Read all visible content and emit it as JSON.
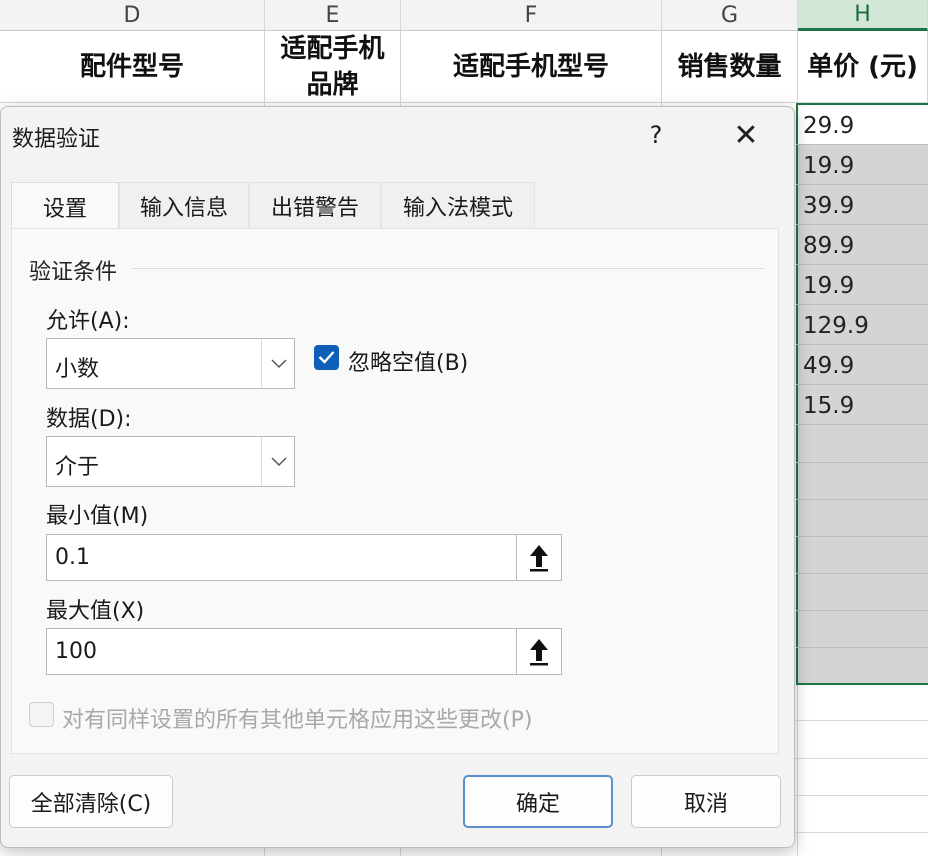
{
  "sheet": {
    "columns": [
      "D",
      "E",
      "F",
      "G",
      "H"
    ],
    "headers": {
      "part_model": "配件型号",
      "brand_line1": "适配手机",
      "brand_line2": "品牌",
      "phone_model": "适配手机型号",
      "sales_qty": "销售数量",
      "unit_price": "单价 (元)"
    },
    "prices": [
      "29.9",
      "19.9",
      "39.9",
      "89.9",
      "19.9",
      "129.9",
      "49.9",
      "15.9"
    ]
  },
  "dialog": {
    "title": "数据验证",
    "help": "?",
    "close": "✕",
    "tabs": [
      "设置",
      "输入信息",
      "出错警告",
      "输入法模式"
    ],
    "criteria_group": "验证条件",
    "allow_label": "允许(A):",
    "allow_value": "小数",
    "ignore_blank_label": "忽略空值(B)",
    "ignore_blank_checked": true,
    "data_label": "数据(D):",
    "data_value": "介于",
    "min_label": "最小值(M)",
    "min_value": "0.1",
    "max_label": "最大值(X)",
    "max_value": "100",
    "apply_all_label": "对有同样设置的所有其他单元格应用这些更改(P)",
    "apply_all_checked": false,
    "clear_all_button": "全部清除(C)",
    "ok_button": "确定",
    "cancel_button": "取消"
  },
  "colors": {
    "accent": "#217346",
    "checkbox": "#0f5fb8",
    "selection": "#d4d4d4"
  }
}
